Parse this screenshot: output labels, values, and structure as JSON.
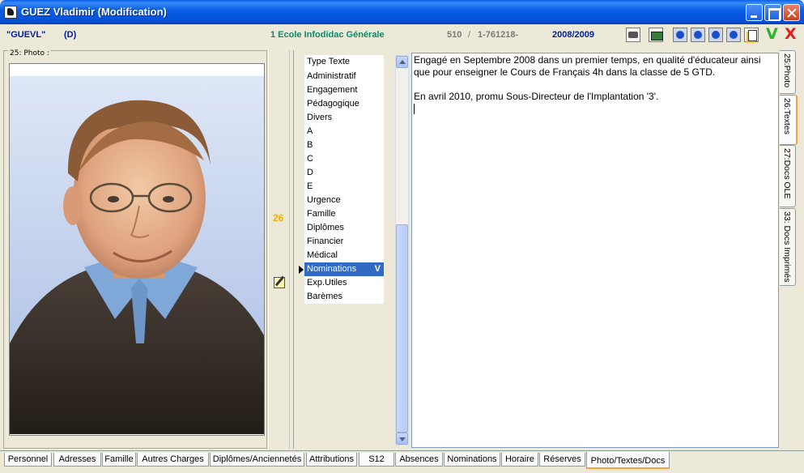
{
  "window": {
    "title": "GUEZ Vladimir (Modification)"
  },
  "info": {
    "code": "\"GUEVL\"",
    "status": "(D)",
    "school": "1 Ecole Infodidac Générale",
    "number": "510",
    "separator": "/",
    "reference": "1-761218-",
    "year": "2008/2009"
  },
  "toolbar": {
    "icons": [
      "print-icon",
      "money-icon",
      "arrow-up-icon",
      "arrow-left-icon",
      "arrow-right-icon",
      "arrow-down-icon",
      "document-icon"
    ],
    "ok_glyph": "V",
    "cancel_glyph": "X"
  },
  "photo": {
    "label": "25: Photo :"
  },
  "record_count": "26",
  "list": {
    "header": "Type Texte",
    "items": [
      "Administratif",
      "Engagement",
      "Pédagogique",
      "Divers",
      "A",
      "B",
      "C",
      "D",
      "E",
      "Urgence",
      "Famille",
      "Diplômes",
      "Financier",
      "Médical",
      "Nominations",
      "Exp.Utiles",
      "Barèmes"
    ],
    "selected": "Nominations",
    "selected_mark": "V"
  },
  "text": {
    "paragraphs": [
      "Engagé en Septembre 2008 dans un premier temps, en qualité d'éducateur ainsi que pour enseigner le Cours de Français 4h dans la classe de 5 GTD.",
      "",
      "En avril 2010, promu Sous-Directeur de l'Implantation '3'."
    ]
  },
  "side_tabs": [
    "25:Photo",
    "26:Textes",
    "27:Docs OLE",
    "33: Docs Imprimés"
  ],
  "side_tab_active": "26:Textes",
  "bottom_tabs": [
    "Personnel",
    "Adresses",
    "Famille",
    "Autres Charges",
    "Diplômes/Anciennetés",
    "Attributions",
    "S12",
    "Absences",
    "Nominations",
    "Horaire",
    "Réserves",
    "Photo/Textes/Docs"
  ],
  "bottom_tab_active": "Photo/Textes/Docs",
  "colors": {
    "accent_blue": "#00209f",
    "school_green": "#0f8a6a",
    "selection": "#316ac5",
    "count_orange": "#f4b000",
    "tab_highlight": "#f2a33a"
  }
}
